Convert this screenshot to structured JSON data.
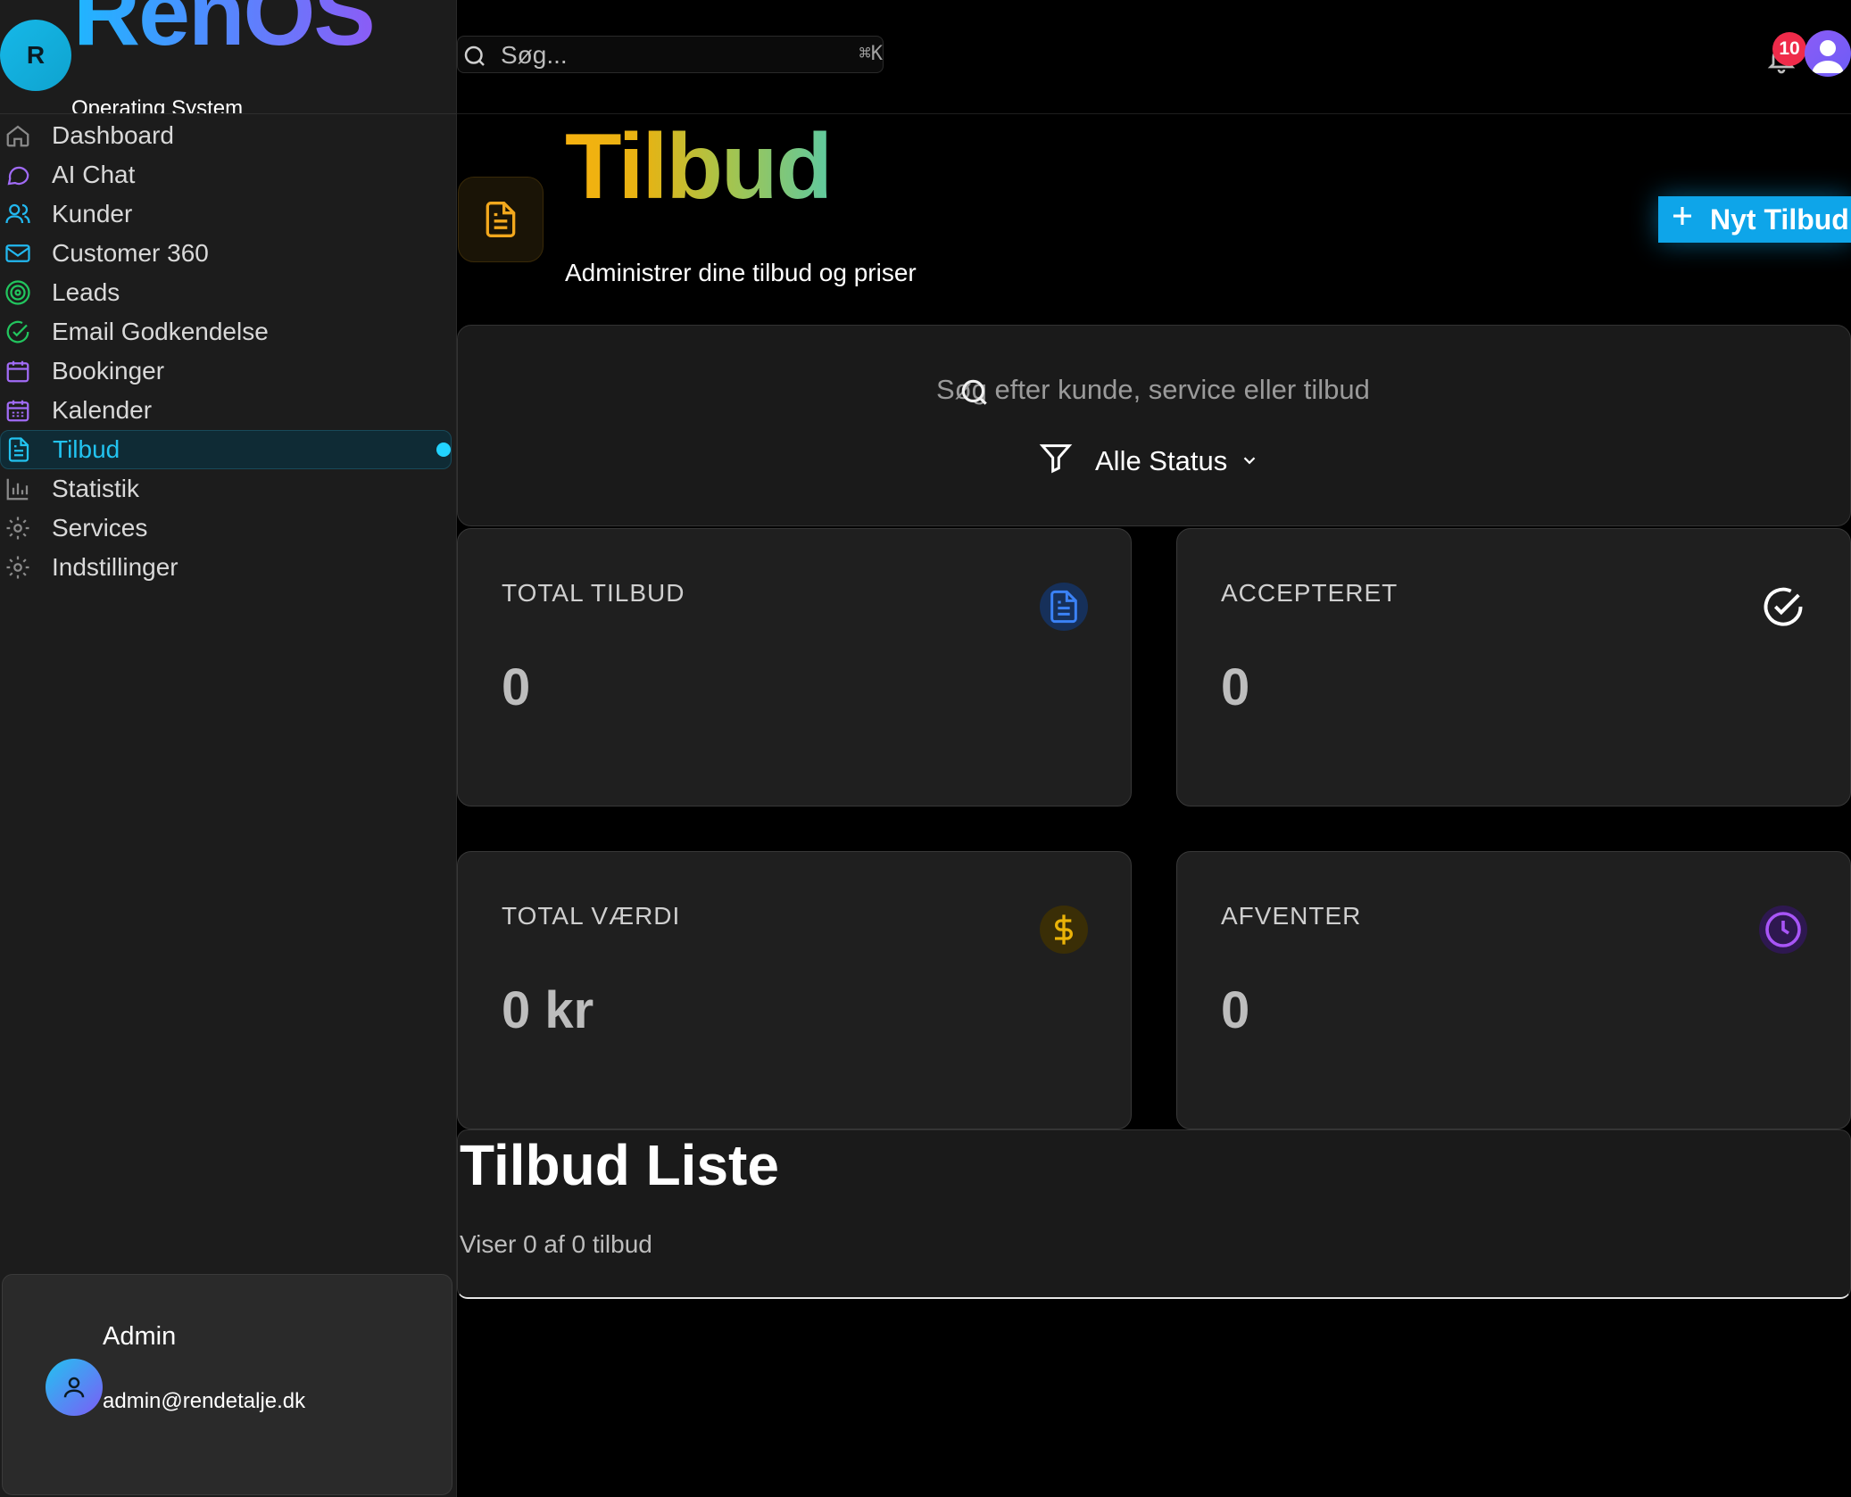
{
  "brand": {
    "initial": "R",
    "name": "RenOS",
    "subtitle": "Operating System"
  },
  "sidebar": {
    "items": [
      {
        "label": "Dashboard",
        "icon": "home-icon",
        "color": "#8a8a8a"
      },
      {
        "label": "AI Chat",
        "icon": "chat-icon",
        "color": "#a16bf6"
      },
      {
        "label": "Kunder",
        "icon": "users-icon",
        "color": "#22b8f0"
      },
      {
        "label": "Customer 360",
        "icon": "mail-icon",
        "color": "#22b8f0"
      },
      {
        "label": "Leads",
        "icon": "target-icon",
        "color": "#22c55e"
      },
      {
        "label": "Email Godkendelse",
        "icon": "check-circle-icon",
        "color": "#22c55e"
      },
      {
        "label": "Bookinger",
        "icon": "calendar-icon",
        "color": "#a16bf6"
      },
      {
        "label": "Kalender",
        "icon": "calendar-grid-icon",
        "color": "#a16bf6"
      },
      {
        "label": "Tilbud",
        "icon": "document-icon",
        "color": "#22c3f0",
        "active": true
      },
      {
        "label": "Statistik",
        "icon": "bar-chart-icon",
        "color": "#8a8a8a"
      },
      {
        "label": "Services",
        "icon": "gear-icon",
        "color": "#8a8a8a"
      },
      {
        "label": "Indstillinger",
        "icon": "gear-icon",
        "color": "#8a8a8a"
      }
    ]
  },
  "user": {
    "name": "Admin",
    "email": "admin@rendetalje.dk"
  },
  "topbar": {
    "search_placeholder": "Søg...",
    "shortcut": "⌘K",
    "notification_count": "10"
  },
  "header": {
    "title": "Tilbud",
    "subtitle": "Administrer dine tilbud og priser",
    "new_button": "Nyt Tilbud"
  },
  "filters": {
    "search_placeholder": "Søg efter kunde, service eller tilbud",
    "status_label": "Alle Status"
  },
  "stats": [
    {
      "label": "TOTAL TILBUD",
      "value": "0",
      "icon": "document-icon",
      "color": "#3b82f6"
    },
    {
      "label": "ACCEPTERET",
      "value": "0",
      "icon": "check-circle-icon",
      "color": "#ffffff"
    },
    {
      "label": "TOTAL VÆRDI",
      "value": "0 kr",
      "icon": "dollar-icon",
      "color": "#eab308"
    },
    {
      "label": "AFVENTER",
      "value": "0",
      "icon": "clock-icon",
      "color": "#a855f7"
    }
  ],
  "list": {
    "title": "Tilbud Liste",
    "summary": "Viser 0 af 0 tilbud"
  }
}
